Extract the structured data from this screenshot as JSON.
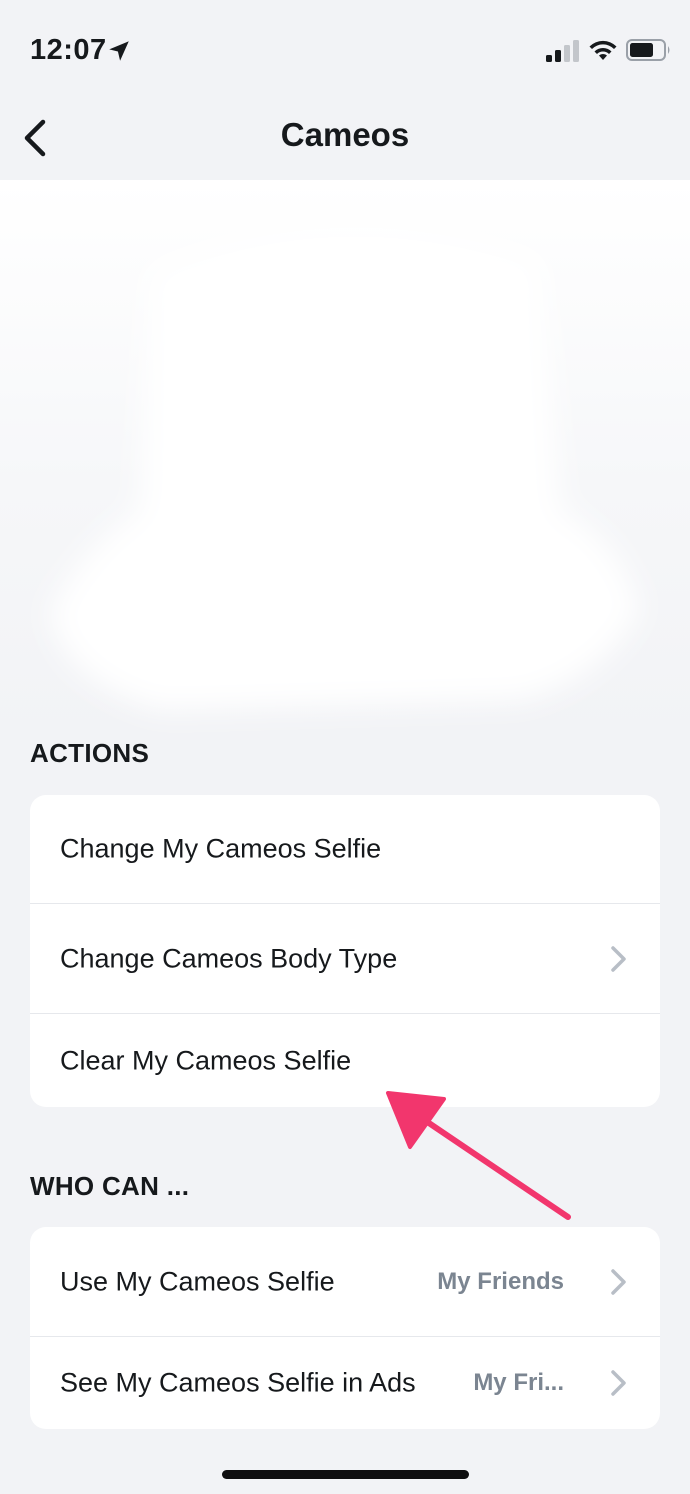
{
  "status_bar": {
    "time": "12:07",
    "icons": [
      "location-arrow-icon",
      "cellular-signal-icon",
      "wifi-icon",
      "battery-icon"
    ]
  },
  "nav": {
    "title": "Cameos",
    "back_icon": "chevron-left-icon"
  },
  "actions_section": {
    "header": "ACTIONS",
    "items": [
      {
        "label": "Change My Cameos Selfie",
        "has_chevron": false
      },
      {
        "label": "Change Cameos Body Type",
        "has_chevron": true
      },
      {
        "label": "Clear My Cameos Selfie",
        "has_chevron": false
      }
    ]
  },
  "who_can_section": {
    "header": "WHO CAN ...",
    "items": [
      {
        "label": "Use My Cameos Selfie",
        "value": "My Friends",
        "has_chevron": true
      },
      {
        "label": "See My Cameos Selfie in Ads",
        "value": "My Fri...",
        "has_chevron": true
      }
    ]
  },
  "annotation": {
    "type": "arrow",
    "color": "#f2366d",
    "points_to": "Clear My Cameos Selfie"
  },
  "colors": {
    "background": "#f2f3f6",
    "card": "#ffffff",
    "text": "#16191c",
    "secondary_text": "#7b8591",
    "chevron": "#b8bec6"
  }
}
